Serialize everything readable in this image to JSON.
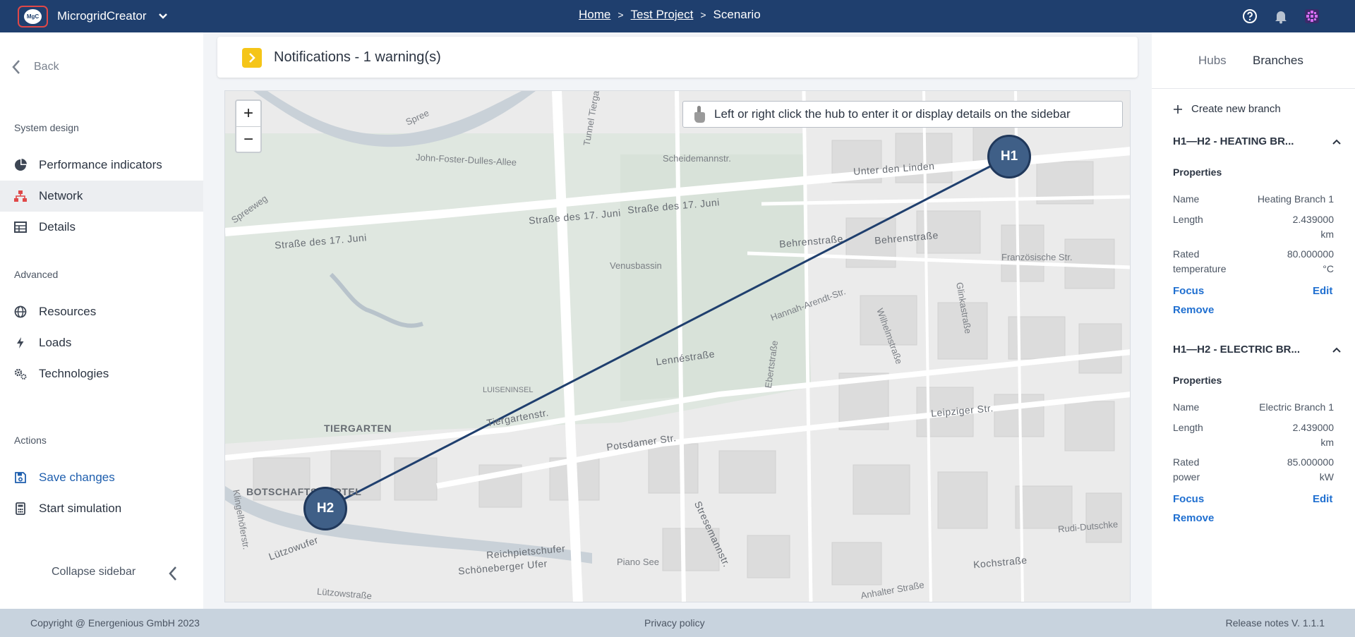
{
  "header": {
    "app_name": "MicrogridCreator",
    "logo_text": "MgC",
    "breadcrumbs": [
      {
        "label": "Home"
      },
      {
        "label": "Test Project"
      },
      {
        "label": "Scenario"
      }
    ],
    "separator": ">"
  },
  "sidebar": {
    "back_label": "Back",
    "sections": {
      "system_design": "System design",
      "advanced": "Advanced",
      "actions": "Actions"
    },
    "items": [
      {
        "label": "Performance indicators",
        "icon": "pie-chart-icon"
      },
      {
        "label": "Network",
        "icon": "network-icon",
        "active": true
      },
      {
        "label": "Details",
        "icon": "table-icon"
      },
      {
        "label": "Resources",
        "icon": "globe-icon"
      },
      {
        "label": "Loads",
        "icon": "bolt-icon"
      },
      {
        "label": "Technologies",
        "icon": "gears-icon"
      }
    ],
    "actions": [
      {
        "label": "Save changes",
        "icon": "save-icon"
      },
      {
        "label": "Start simulation",
        "icon": "calculator-icon"
      }
    ],
    "collapse_label": "Collapse sidebar"
  },
  "notification": {
    "title": "Notifications - 1 warning(s)"
  },
  "map": {
    "zoom_in": "+",
    "zoom_out": "−",
    "hint": "Left or right click the hub to enter it or display details on the sidebar",
    "hubs": [
      {
        "label": "H1"
      },
      {
        "label": "H2"
      }
    ],
    "labels": [
      "Spree",
      "John-Foster-Dulles-Allee",
      "Tunnel Tiergarten",
      "Scheidemannstr.",
      "Unter den Linden",
      "Straße des 17. Juni",
      "Straße des 17. Juni",
      "Straße des 17. Juni",
      "Spreeweg",
      "Venusbassin",
      "Behrenstraße",
      "Behrenstraße",
      "Französische Str.",
      "Hannah-Arendt-Str.",
      "Wilhelmstraße",
      "Glinkastraße",
      "Lennéstraße",
      "Ebertstraße",
      "LUISENINSEL",
      "TIERGARTEN",
      "Tiergartenstr.",
      "Leipziger Str.",
      "Potsdamer Str.",
      "BOTSCHAFTSVIERTEL",
      "Klingelhöferstr.",
      "Lützowufer",
      "Reichpietschufer",
      "Schöneberger Ufer",
      "Piano See",
      "Stresemannstr.",
      "Kochstraße",
      "Rudi-Dutschke",
      "Anhalter Straße",
      "Lützowstraße"
    ],
    "line_color": "#1f3f6e",
    "hub_color": "#3f5f87"
  },
  "right_panel": {
    "tabs": [
      {
        "label": "Hubs",
        "active": false
      },
      {
        "label": "Branches",
        "active": true
      }
    ],
    "create_label": "Create new branch",
    "properties_label": "Properties",
    "branches": [
      {
        "title": "H1—H2 - HEATING BR...",
        "props": [
          {
            "key": "Name",
            "value": "Heating Branch 1"
          },
          {
            "key": "Length",
            "value": "2.439000 km"
          },
          {
            "key": "Rated temperature",
            "value": "80.000000 °C"
          }
        ],
        "focus": "Focus",
        "edit": "Edit",
        "remove": "Remove"
      },
      {
        "title": "H1—H2 - ELECTRIC BR...",
        "props": [
          {
            "key": "Name",
            "value": "Electric Branch 1"
          },
          {
            "key": "Length",
            "value": "2.439000 km"
          },
          {
            "key": "Rated power",
            "value": "85.000000 kW"
          }
        ],
        "focus": "Focus",
        "edit": "Edit",
        "remove": "Remove"
      }
    ]
  },
  "footer": {
    "copyright": "Copyright @ Energenious GmbH 2023",
    "privacy": "Privacy policy",
    "release": "Release notes V. 1.1.1"
  }
}
